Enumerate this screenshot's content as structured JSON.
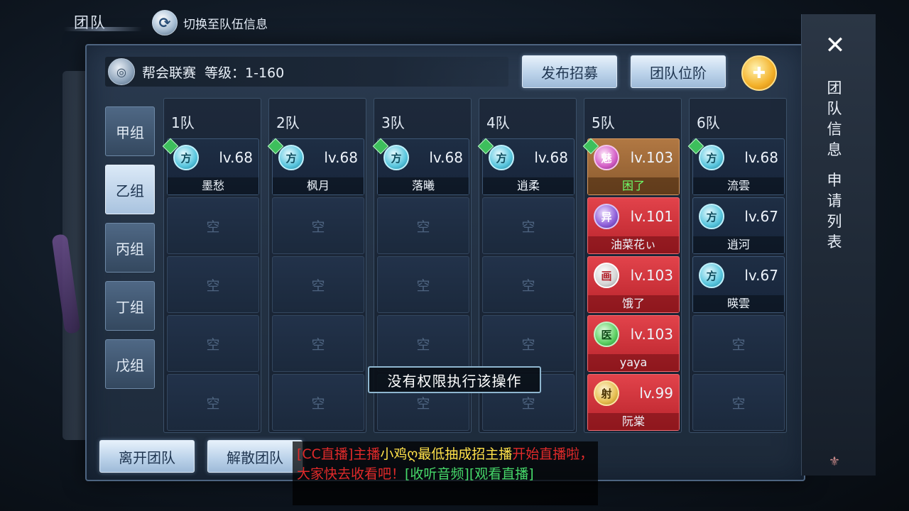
{
  "header": {
    "title": "团队",
    "switch_label": "切换至队伍信息"
  },
  "league": {
    "name": "帮会联赛",
    "level": "等级：1-160",
    "publish_label": "发布招募",
    "rank_label": "团队位阶"
  },
  "groups": [
    "甲组",
    "乙组",
    "丙组",
    "丁组",
    "戊组"
  ],
  "active_group": "乙组",
  "empty_label": "空",
  "teams": [
    {
      "label": "1队",
      "members": [
        {
          "badge": "方",
          "level": "lv.68",
          "name": "墨愁"
        }
      ]
    },
    {
      "label": "2队",
      "members": [
        {
          "badge": "方",
          "level": "lv.68",
          "name": "枫月"
        }
      ]
    },
    {
      "label": "3队",
      "members": [
        {
          "badge": "方",
          "level": "lv.68",
          "name": "落曦"
        }
      ]
    },
    {
      "label": "4队",
      "members": [
        {
          "badge": "方",
          "level": "lv.68",
          "name": "逍柔"
        }
      ]
    },
    {
      "label": "5队",
      "members": [
        {
          "badge": "魅",
          "level": "lv.103",
          "name": "困了"
        },
        {
          "badge": "异",
          "level": "lv.101",
          "name": "油菜花ぃ"
        },
        {
          "badge": "画",
          "level": "lv.103",
          "name": "饿了"
        },
        {
          "badge": "医",
          "level": "lv.103",
          "name": "yaya"
        },
        {
          "badge": "射",
          "level": "lv.99",
          "name": "阮棠"
        }
      ]
    },
    {
      "label": "6队",
      "members": [
        {
          "badge": "方",
          "level": "lv.68",
          "name": "流雲"
        },
        {
          "badge": "方",
          "level": "lv.67",
          "name": "逍河"
        },
        {
          "badge": "方",
          "level": "lv.67",
          "name": "暎雲"
        }
      ]
    }
  ],
  "footer": {
    "leave_label": "离开团队",
    "disband_label": "解散团队"
  },
  "toast": "没有权限执行该操作",
  "broadcast": {
    "prefix": "[CC直播]主播",
    "host": "小鸡ღ最低抽成招主播",
    "message": "开始直播啦，大家快去收看吧！",
    "listen": "[收听音频]",
    "watch": "[观看直播]"
  },
  "side_tabs": [
    "团队信息",
    "申请列表"
  ],
  "colors": {
    "accent_light": "#bcd3ea",
    "member_red": "#d33038",
    "member_brown": "#a06a3a",
    "broadcast_red": "#e12a2a",
    "broadcast_yellow": "#ffe14a",
    "broadcast_green": "#46d96a"
  }
}
